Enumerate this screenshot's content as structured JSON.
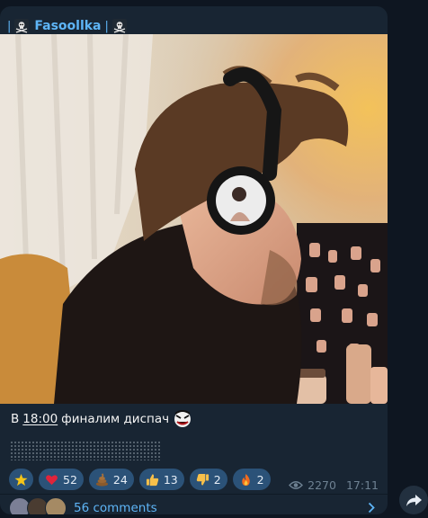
{
  "channel": {
    "name": "Fasoollka",
    "separator_left": "|",
    "separator_right": "|"
  },
  "post": {
    "caption_prefix": "В",
    "caption_time": "18:00",
    "caption_text": "финалим диспач",
    "reactions": [
      {
        "icon": "star-icon",
        "count": ""
      },
      {
        "icon": "heart-icon",
        "count": "52"
      },
      {
        "icon": "poop-icon",
        "count": "24"
      },
      {
        "icon": "thumbs-up-icon",
        "count": "13"
      },
      {
        "icon": "thumbs-down-icon",
        "count": "2"
      },
      {
        "icon": "fire-icon",
        "count": "2"
      }
    ],
    "views": "2270",
    "time": "17:11",
    "comments_label": "56 comments"
  },
  "colors": {
    "background": "#0e1621",
    "bubble": "#182533",
    "accent": "#5eb5f7",
    "reaction_bg": "#2b5278",
    "meta": "#6e8192"
  }
}
